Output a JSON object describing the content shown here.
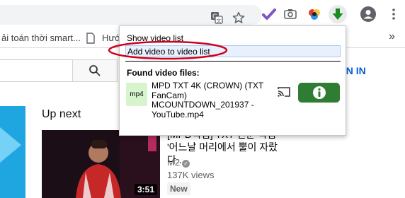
{
  "toolbar": {
    "icons": [
      "translate-icon",
      "star-icon",
      "extension-icon",
      "camera-icon",
      "colors-icon",
      "download-arrow-icon",
      "profile-icon",
      "menu-icon"
    ]
  },
  "bookmarks": {
    "item1": "ải toán thời smart...",
    "item2": "Hướ",
    "overflow": "»"
  },
  "youtube": {
    "signin": "IGN IN",
    "up_next": "Up next",
    "video": {
      "duration": "3:51",
      "title": "[MPD직캠] TXT 연준 직캠 '어느날 머리에서 뿔이 자랐다...",
      "channel": "M2",
      "views": "137K views",
      "badge": "New"
    }
  },
  "popup": {
    "show_list": "Show video list",
    "add_to_list": "Add video to video list",
    "found_header": "Found video files:",
    "file_type": "mp4",
    "file_name": "MPD TXT 4K (CROWN) (TXT FanCam) MCOUNTDOWN_201937 - YouTube.mp4",
    "colors": {
      "info_button": "#2e7d32",
      "mp4_badge": "#d6f5cc",
      "annotation": "#d0021b"
    }
  }
}
